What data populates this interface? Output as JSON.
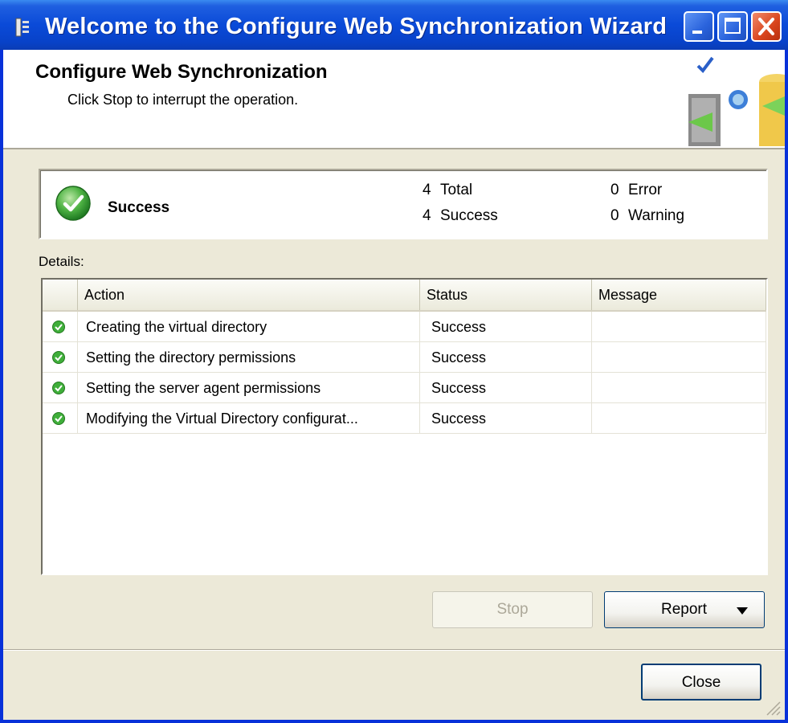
{
  "window": {
    "title": "Welcome to the Configure Web Synchronization Wizard",
    "controls": {
      "minimize": "minimize",
      "maximize": "maximize",
      "close": "close"
    }
  },
  "header": {
    "title": "Configure Web Synchronization",
    "subtitle": "Click Stop to interrupt the operation."
  },
  "summary": {
    "status": "Success",
    "total": {
      "count": "4",
      "label": "Total"
    },
    "success": {
      "count": "4",
      "label": "Success"
    },
    "error": {
      "count": "0",
      "label": "Error"
    },
    "warning": {
      "count": "0",
      "label": "Warning"
    }
  },
  "details": {
    "label": "Details:",
    "columns": [
      "Action",
      "Status",
      "Message"
    ],
    "rows": [
      {
        "icon": "success-check-icon",
        "action": "Creating the virtual directory",
        "status": "Success",
        "message": ""
      },
      {
        "icon": "success-check-icon",
        "action": "Setting the directory permissions",
        "status": "Success",
        "message": ""
      },
      {
        "icon": "success-check-icon",
        "action": "Setting the server agent permissions",
        "status": "Success",
        "message": ""
      },
      {
        "icon": "success-check-icon",
        "action": "Modifying the Virtual Directory configurat...",
        "status": "Success",
        "message": ""
      }
    ]
  },
  "buttons": {
    "stop": "Stop",
    "report": "Report",
    "close": "Close"
  },
  "colors": {
    "titlebar": "#0a4ad8",
    "dialog_bg": "#ece9d8",
    "success_green": "#3fae3a"
  }
}
